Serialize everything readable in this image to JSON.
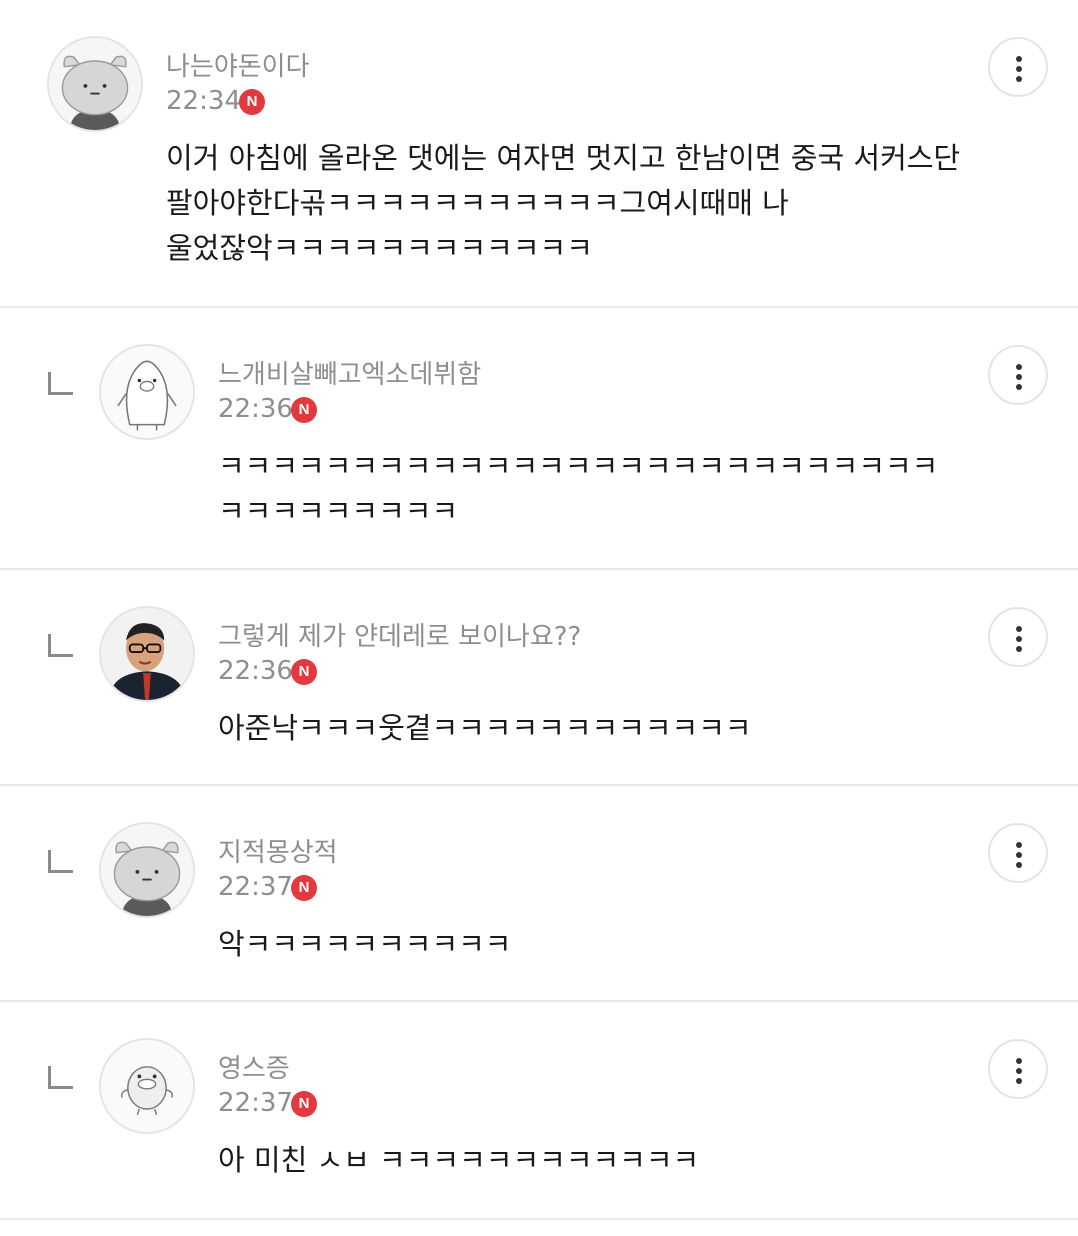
{
  "comments": [
    {
      "author": "나는야돈이다",
      "time": "22:34",
      "badge": "N",
      "body": "이거 아침에 올라온 댓에는 여자면 멋지고 한남이면 중국 서커스단\n팔아야한다곢ㅋㅋㅋㅋㅋㅋㅋㅋㅋㅋㅋ그여시때매 나\n울었잖악ㅋㅋㅋㅋㅋㅋㅋㅋㅋㅋㅋㅋ",
      "avatar": "bear-icon",
      "is_reply": false
    },
    {
      "author": "느개비살빼고엑소데뷔함",
      "time": "22:36",
      "badge": "N",
      "body": "ㅋㅋㅋㅋㅋㅋㅋㅋㅋㅋㅋㅋㅋㅋㅋㅋㅋㅋㅋㅋㅋㅋㅋㅋㅋㅋㅋ\nㅋㅋㅋㅋㅋㅋㅋㅋㅋ",
      "avatar": "penguin-icon",
      "is_reply": true
    },
    {
      "author": "그렇게 제가 얀데레로 보이나요??",
      "time": "22:36",
      "badge": "N",
      "body": "아준낙ㅋㅋㅋ웃곁ㅋㅋㅋㅋㅋㅋㅋㅋㅋㅋㅋㅋ",
      "avatar": "person-photo",
      "is_reply": true
    },
    {
      "author": "지적몽상적",
      "time": "22:37",
      "badge": "N",
      "body": "악ㅋㅋㅋㅋㅋㅋㅋㅋㅋㅋ",
      "avatar": "bear-icon",
      "is_reply": true
    },
    {
      "author": "영스증",
      "time": "22:37",
      "badge": "N",
      "body": "아 미친 ㅅㅂ ㅋㅋㅋㅋㅋㅋㅋㅋㅋㅋㅋㅋ",
      "avatar": "duck-icon",
      "is_reply": true
    }
  ],
  "colors": {
    "badge": "#e2393f",
    "meta_text": "#8e8e8e",
    "body_text": "#1a1a1a",
    "divider": "#e8e8e8"
  }
}
